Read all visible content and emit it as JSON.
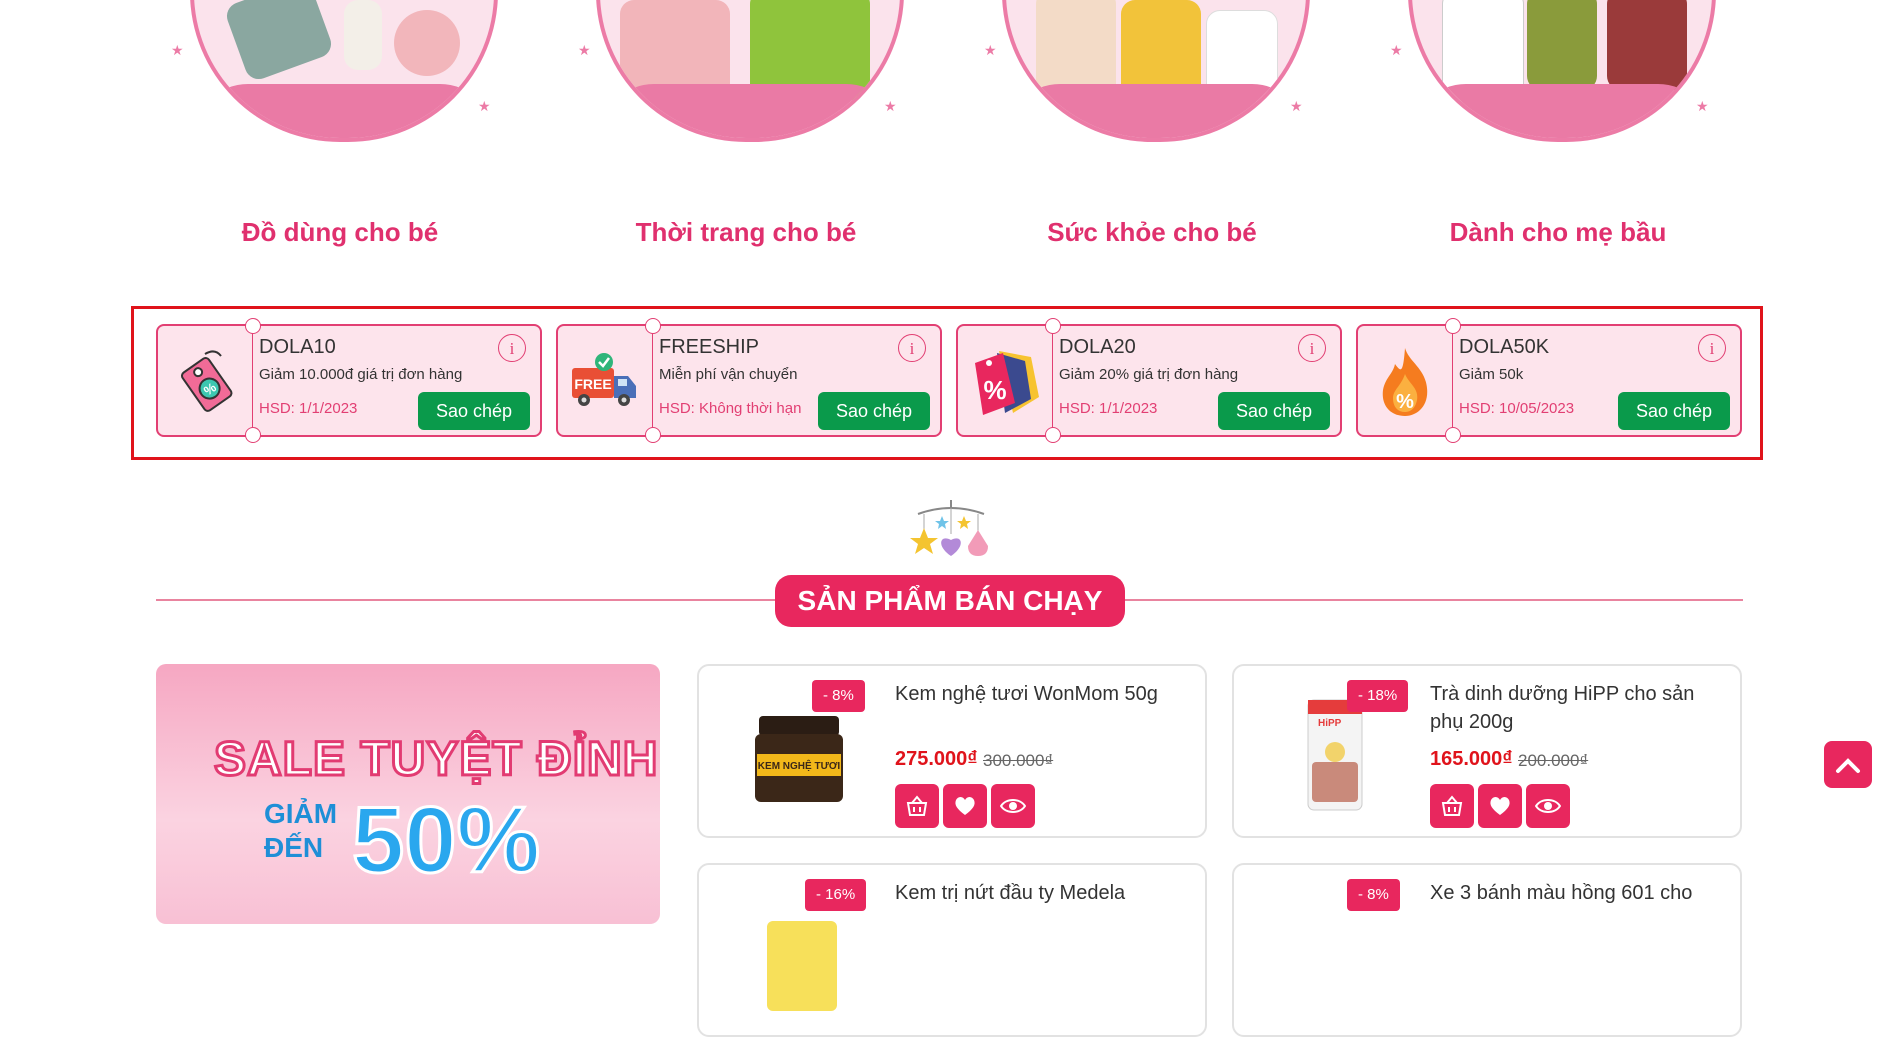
{
  "categories": [
    {
      "title": "Đồ dùng cho bé"
    },
    {
      "title": "Thời trang cho bé"
    },
    {
      "title": "Sức khỏe cho bé"
    },
    {
      "title": "Dành cho mẹ bầu"
    }
  ],
  "coupons": [
    {
      "code": "DOLA10",
      "desc": "Giảm 10.000đ giá trị đơn hàng",
      "expiry": "HSD: 1/1/2023",
      "copy_label": "Sao chép",
      "info": "i",
      "icon": "discount-tag-icon"
    },
    {
      "code": "FREESHIP",
      "desc": "Miễn phí vận chuyển",
      "expiry": "HSD: Không thời hạn",
      "copy_label": "Sao chép",
      "info": "i",
      "icon": "free-delivery-truck-icon",
      "icon_text": "FREE"
    },
    {
      "code": "DOLA20",
      "desc": "Giảm 20% giá trị đơn hàng",
      "expiry": "HSD: 1/1/2023",
      "copy_label": "Sao chép",
      "info": "i",
      "icon": "percent-tag-icon",
      "icon_text": "%"
    },
    {
      "code": "DOLA50K",
      "desc": "Giảm 50k",
      "expiry": "HSD: 10/05/2023",
      "copy_label": "Sao chép",
      "info": "i",
      "icon": "fire-percent-icon",
      "icon_text": "%"
    }
  ],
  "section": {
    "title": "SẢN PHẨM BÁN CHẠY"
  },
  "banner": {
    "line1": "SALE TUYỆT ĐỈNH",
    "line2": "GIẢM",
    "line3": "ĐẾN",
    "line4": "50%"
  },
  "products": [
    {
      "name": "Kem nghệ tươi WonMom 50g",
      "discount": "- 8%",
      "price": "275.000₫",
      "old_price": "300.000₫",
      "image_text": "KEM NGHỆ TƯƠI"
    },
    {
      "name": "Trà dinh dưỡng HiPP cho sản phụ 200g",
      "discount": "- 18%",
      "price": "165.000₫",
      "old_price": "200.000₫",
      "image_text": "HiPP"
    },
    {
      "name": "Kem trị nứt đầu ty Medela",
      "discount": "- 16%"
    },
    {
      "name": "Xe 3 bánh màu hồng 601 cho",
      "discount": "- 8%"
    }
  ],
  "colors": {
    "primary": "#e8275e",
    "green": "#0a9a4b",
    "highlight": "#e0131b"
  }
}
